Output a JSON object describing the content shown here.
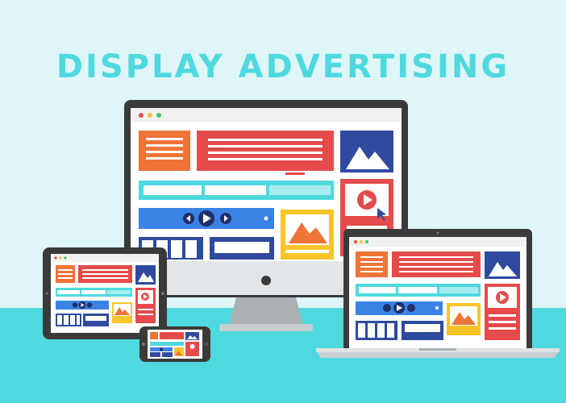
{
  "title": "DISPLAY ADVERTISING",
  "colors": {
    "background": "#dff6f9",
    "floor": "#4fd9df",
    "title": "#4fd9df",
    "bezel": "#3a3a3a",
    "stand": "#b9bfc2",
    "orange": "#ee7438",
    "red": "#e54b4b",
    "navy": "#2f4a9f",
    "teal": "#4fd9df",
    "blue": "#3b82e5",
    "yellow": "#f7c52a"
  },
  "icons": {
    "window_dots": "red-yellow-green-dots",
    "image": "mountain-image-icon",
    "video": "play-button-icon",
    "cursor": "mouse-cursor-icon",
    "player_controls": "rewind-play-forward-icons"
  },
  "devices": [
    "desktop-monitor",
    "laptop",
    "tablet",
    "smartphone"
  ]
}
